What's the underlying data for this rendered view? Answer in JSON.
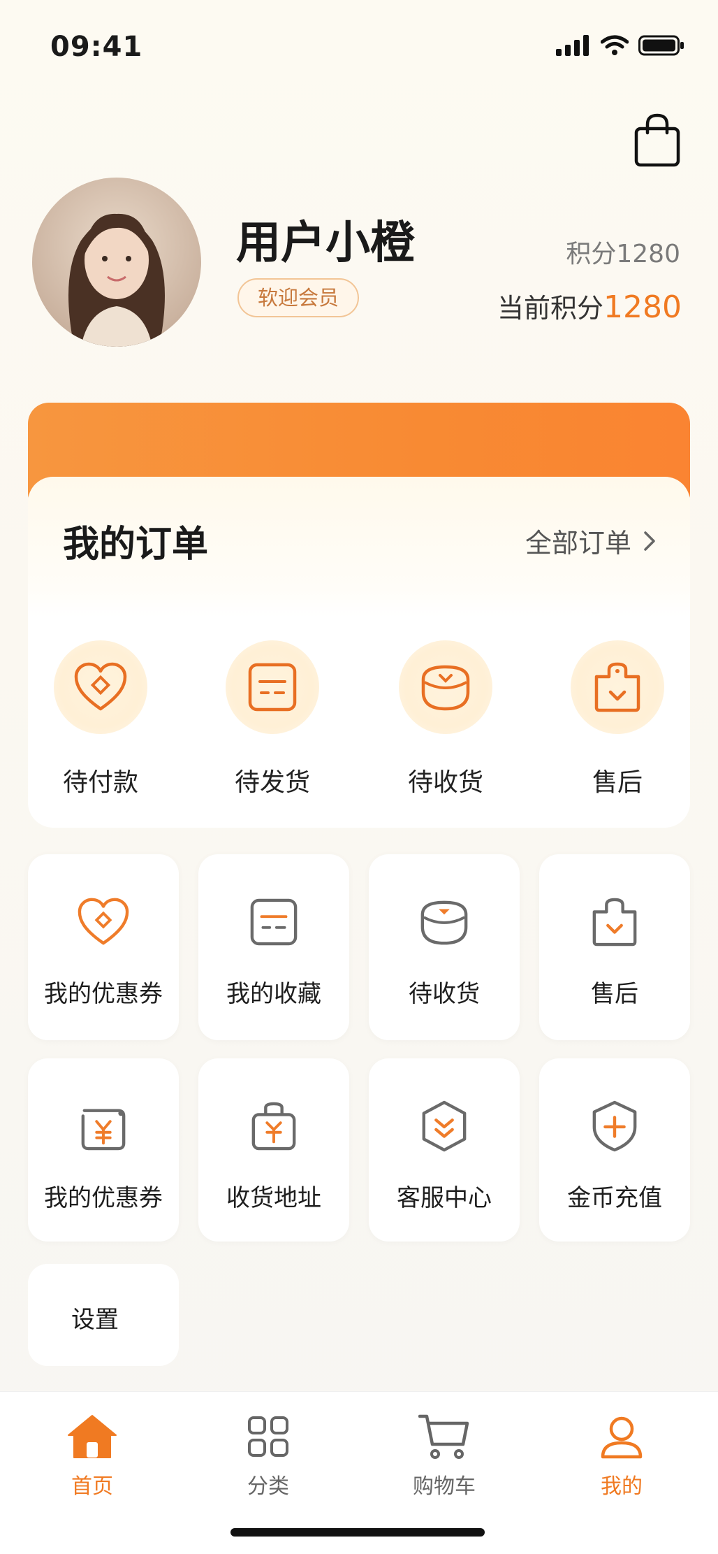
{
  "status_bar": {
    "time": "09:41"
  },
  "profile": {
    "username": "用户小橙",
    "member_badge": "软迎会员",
    "points_top": "积分1280",
    "points_current_label": "当前积分",
    "points_current_value": "1280"
  },
  "orders": {
    "title": "我的订单",
    "all_link": "全部订单",
    "items": [
      {
        "label": "待付款",
        "icon": "heart-tag-icon"
      },
      {
        "label": "待发货",
        "icon": "package-box-icon"
      },
      {
        "label": "待收货",
        "icon": "bowl-box-icon"
      },
      {
        "label": "售后",
        "icon": "service-bag-icon"
      }
    ]
  },
  "services_row1": [
    {
      "label": "我的优惠券",
      "icon": "heart-coupon-icon"
    },
    {
      "label": "我的收藏",
      "icon": "box-icon"
    },
    {
      "label": "待收货",
      "icon": "bowl-box-icon"
    },
    {
      "label": "售后",
      "icon": "service-bag-icon"
    }
  ],
  "services_row2": [
    {
      "label": "我的优惠券",
      "icon": "yen-tag-icon"
    },
    {
      "label": "收货地址",
      "icon": "yen-bag-icon"
    },
    {
      "label": "客服中心",
      "icon": "hexagon-download-icon"
    },
    {
      "label": "金币充值",
      "icon": "shield-plus-icon"
    }
  ],
  "settings": {
    "label": "设置"
  },
  "tabbar": [
    {
      "label": "首页",
      "icon": "home-icon",
      "active": true
    },
    {
      "label": "分类",
      "icon": "grid-icon",
      "active": false
    },
    {
      "label": "购物车",
      "icon": "cart-icon",
      "active": false
    },
    {
      "label": "我的",
      "icon": "user-icon",
      "active": false
    }
  ],
  "colors": {
    "accent": "#f07a22",
    "tab_active": "#f07a22",
    "tab_inactive": "#666666"
  }
}
